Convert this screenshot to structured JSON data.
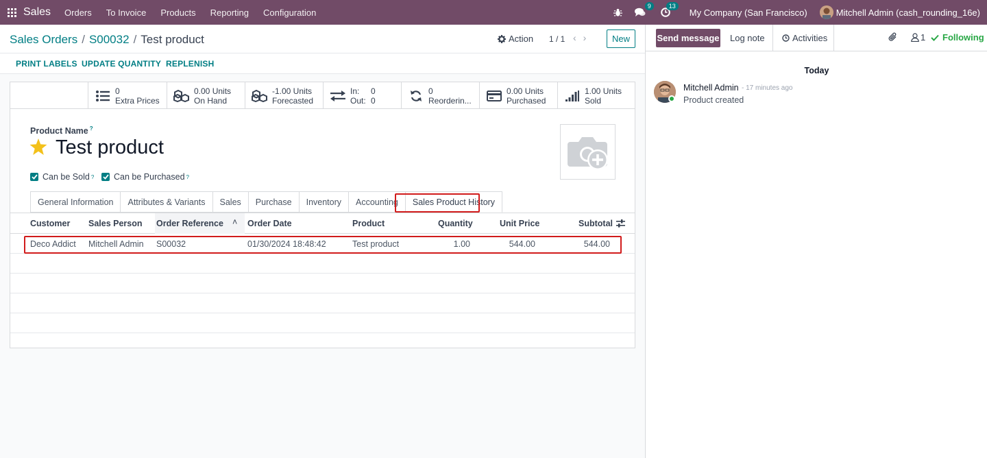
{
  "navbar": {
    "brand": "Sales",
    "menus": [
      "Orders",
      "To Invoice",
      "Products",
      "Reporting",
      "Configuration"
    ],
    "messages_badge": "9",
    "activities_badge": "13",
    "company": "My Company (San Francisco)",
    "user": "Mitchell Admin (cash_rounding_16e)"
  },
  "control": {
    "breadcrumb": [
      "Sales Orders",
      "S00032",
      "Test product"
    ],
    "action_label": "Action",
    "pager": "1 / 1",
    "new_label": "New"
  },
  "statusbar": {
    "buttons": [
      "PRINT LABELS",
      "UPDATE QUANTITY",
      "REPLENISH"
    ]
  },
  "stats": [
    {
      "icon": "list-icon",
      "value": "0",
      "label": "Extra Prices"
    },
    {
      "icon": "cubes-icon",
      "value": "0.00 Units",
      "label": "On Hand"
    },
    {
      "icon": "cubes-icon",
      "value": "-1.00 Units",
      "label": "Forecasted"
    },
    {
      "icon": "exchange-icon",
      "value_in_label": "In:",
      "value_in": "0",
      "value_out_label": "Out:",
      "value_out": "0"
    },
    {
      "icon": "refresh-icon",
      "value": "0",
      "label": "Reorderin..."
    },
    {
      "icon": "credit-card-icon",
      "value": "0.00 Units",
      "label": "Purchased"
    },
    {
      "icon": "signal-icon",
      "value": "1.00 Units",
      "label": "Sold"
    }
  ],
  "form": {
    "name_label": "Product Name",
    "help_mark": "?",
    "product_name": "Test product",
    "can_be_sold": "Can be Sold",
    "can_be_purchased": "Can be Purchased"
  },
  "tabs": [
    "General Information",
    "Attributes & Variants",
    "Sales",
    "Purchase",
    "Inventory",
    "Accounting",
    "Sales Product History"
  ],
  "table": {
    "headers": [
      "Customer",
      "Sales Person",
      "Order Reference",
      "Order Date",
      "Product",
      "Quantity",
      "Unit Price",
      "Subtotal"
    ],
    "rows": [
      [
        "Deco Addict",
        "Mitchell Admin",
        "S00032",
        "01/30/2024 18:48:42",
        "Test product",
        "1.00",
        "544.00",
        "544.00"
      ]
    ]
  },
  "chatter": {
    "send_message": "Send message",
    "log_note": "Log note",
    "activities": "Activities",
    "followers_count": "1",
    "following": "Following",
    "date_separator": "Today",
    "message": {
      "author": "Mitchell Admin",
      "time": "- 17 minutes ago",
      "body": "Product created"
    }
  },
  "colors": {
    "brand": "#714b67",
    "accent": "#017e84",
    "highlight": "#d11b1b",
    "star": "#f3c11b"
  }
}
